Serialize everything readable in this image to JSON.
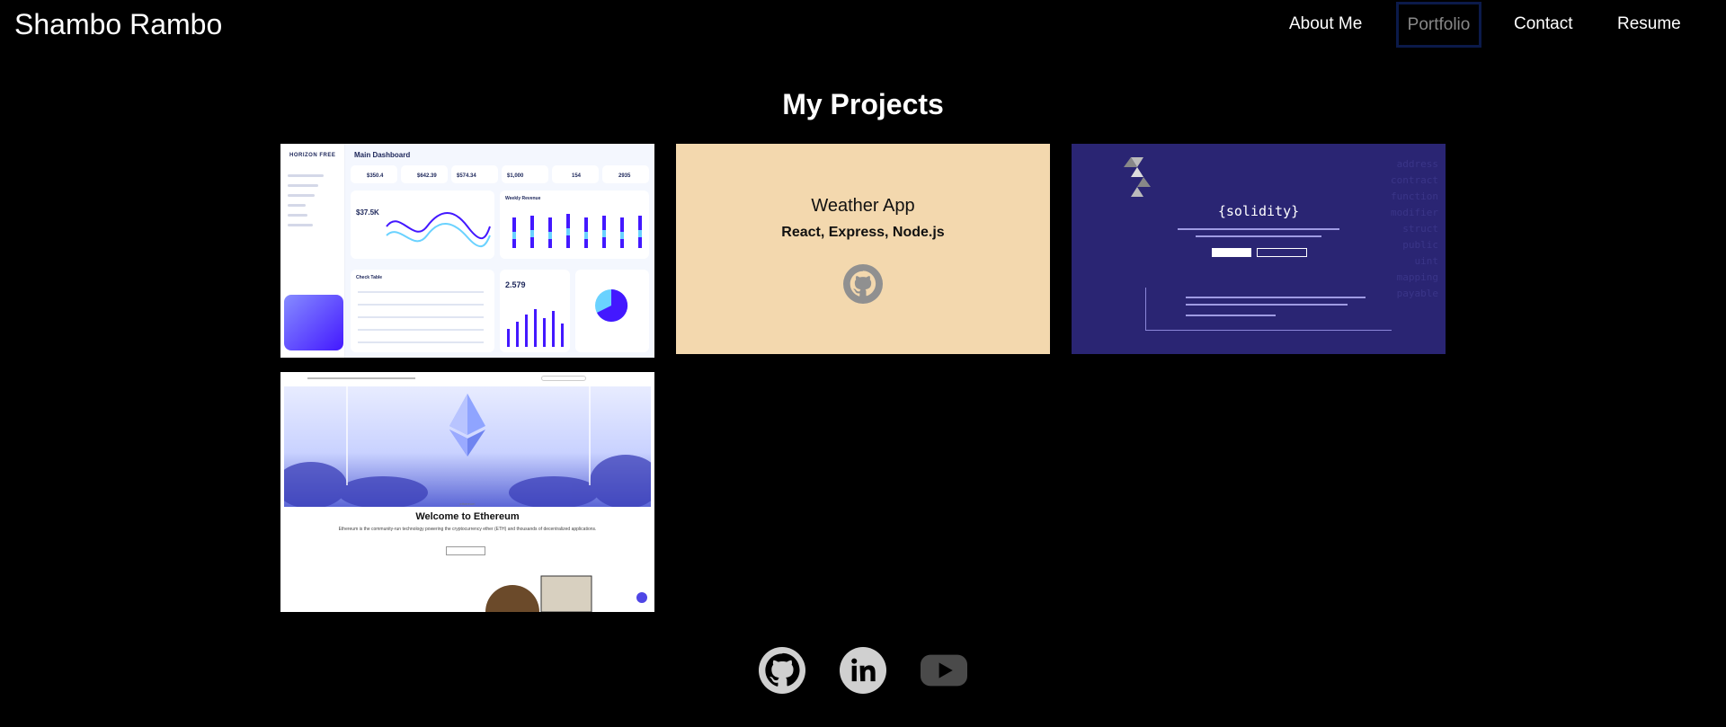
{
  "header": {
    "brand": "Shambo Rambo",
    "nav": [
      "About Me",
      "Portfolio",
      "Contact",
      "Resume"
    ],
    "active_nav": "Portfolio"
  },
  "main": {
    "title": "My Projects",
    "projects": [
      {
        "kind": "screenshot",
        "thumb_logo": "HORIZON FREE",
        "thumb_title": "Main Dashboard",
        "thumb_stats": [
          "$350.4",
          "$642.39",
          "$574.34",
          "$1,000",
          "154",
          "2935"
        ],
        "thumb_values": [
          "$37.5K",
          "2.579"
        ],
        "thumb_panels": [
          "Weekly Revenue",
          "Check Table"
        ]
      },
      {
        "kind": "text",
        "title": "Weather App",
        "stack": "React, Express, Node.js",
        "icon": "github-icon"
      },
      {
        "kind": "screenshot",
        "thumb_title": "{solidity}",
        "thumb_code_words": [
          "address",
          "contract",
          "function",
          "modifier",
          "struct",
          "public",
          "uint",
          "mapping",
          "payable"
        ]
      },
      {
        "kind": "screenshot",
        "thumb_label": "ethereum",
        "thumb_title": "Welcome to Ethereum",
        "thumb_sub": "Ethereum is the community-run technology powering the cryptocurrency ether (ETH) and thousands of decentralized applications."
      }
    ]
  },
  "footer": {
    "icons": [
      "github-icon",
      "linkedin-icon",
      "youtube-icon"
    ]
  },
  "colors": {
    "background": "#000000",
    "text": "#ffffff",
    "active_nav_border": "#0b1a4a",
    "weather_card": "#f3d8ae",
    "solidity_card": "#2a2573"
  }
}
